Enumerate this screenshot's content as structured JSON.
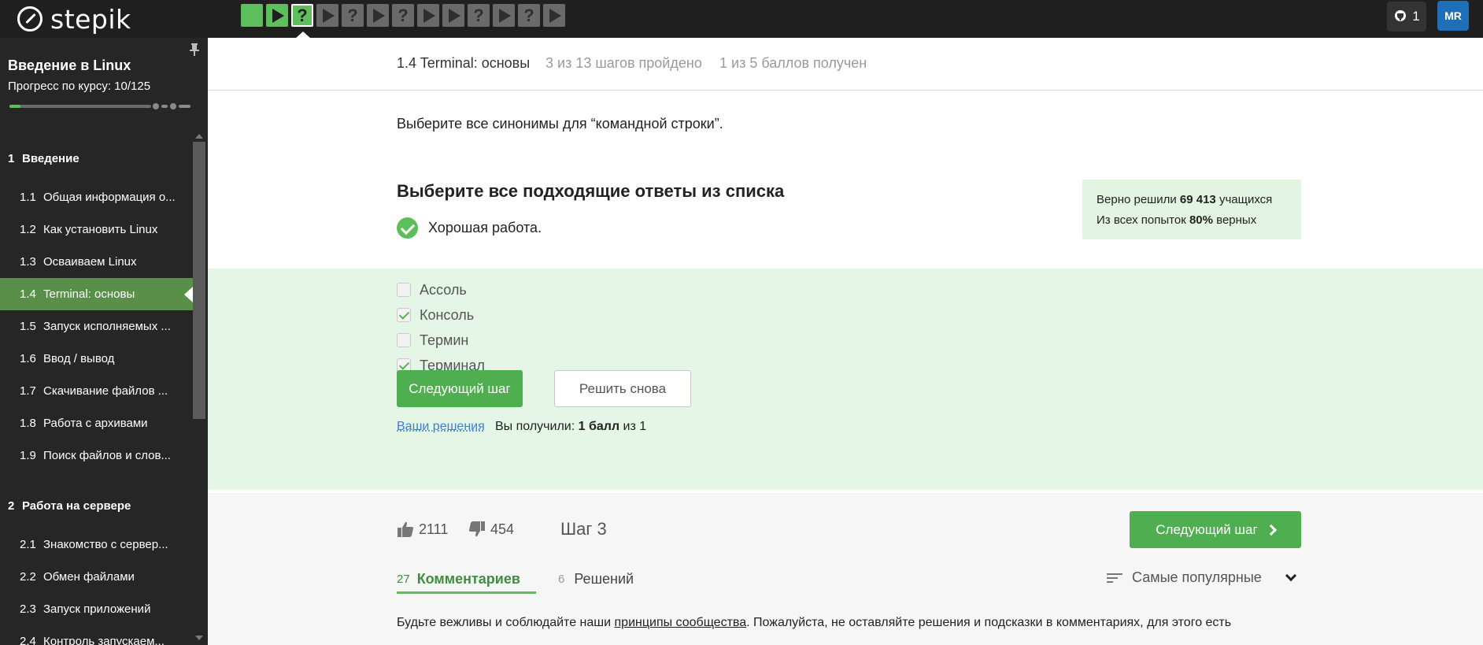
{
  "brand": {
    "name": "stepik"
  },
  "steps": [
    {
      "kind": "done"
    },
    {
      "kind": "video-done"
    },
    {
      "kind": "quiz-current"
    },
    {
      "kind": "video"
    },
    {
      "kind": "quiz"
    },
    {
      "kind": "video"
    },
    {
      "kind": "quiz"
    },
    {
      "kind": "video"
    },
    {
      "kind": "video"
    },
    {
      "kind": "quiz"
    },
    {
      "kind": "video"
    },
    {
      "kind": "quiz"
    },
    {
      "kind": "video"
    }
  ],
  "step_glyphs": {
    "quiz": "?"
  },
  "header_right": {
    "trophy_count": "1",
    "avatar_initials": "MR"
  },
  "sidebar": {
    "course_title": "Введение в Linux",
    "progress_text": "Прогресс по курсу:  10/125",
    "progress_fraction": 0.08,
    "modules": [
      {
        "title_num": "1",
        "title": "Введение",
        "lessons": [
          {
            "num": "1.1",
            "title": "Общая информация о..."
          },
          {
            "num": "1.2",
            "title": "Как установить Linux"
          },
          {
            "num": "1.3",
            "title": "Осваиваем Linux"
          },
          {
            "num": "1.4",
            "title": "Terminal: основы",
            "active": true
          },
          {
            "num": "1.5",
            "title": "Запуск исполняемых ..."
          },
          {
            "num": "1.6",
            "title": "Ввод / вывод"
          },
          {
            "num": "1.7",
            "title": "Скачивание файлов ..."
          },
          {
            "num": "1.8",
            "title": "Работа с архивами"
          },
          {
            "num": "1.9",
            "title": "Поиск файлов и слов..."
          }
        ]
      },
      {
        "title_num": "2",
        "title": "Работа на сервере",
        "lessons": [
          {
            "num": "2.1",
            "title": "Знакомство с сервер..."
          },
          {
            "num": "2.2",
            "title": "Обмен файлами"
          },
          {
            "num": "2.3",
            "title": "Запуск приложений"
          },
          {
            "num": "2.4",
            "title": "Контроль запускаем..."
          }
        ]
      }
    ]
  },
  "lesson_header": {
    "title": "1.4 Terminal: основы",
    "steps_done": "3 из 13 шагов пройдено",
    "score": "1 из 5 баллов  получен"
  },
  "question": "Выберите все синонимы для “командной строки”.",
  "subtitle": "Выберите все подходящие ответы из списка",
  "feedback": "Хорошая работа.",
  "stats": {
    "line1_pre": "Верно решили ",
    "line1_num": "69 413",
    "line1_post": " учащихся",
    "line2_pre": "Из всех попыток ",
    "line2_num": "80%",
    "line2_post": " верных"
  },
  "options": [
    {
      "label": "Ассоль",
      "checked": false
    },
    {
      "label": "Консоль",
      "checked": true
    },
    {
      "label": "Термин",
      "checked": false
    },
    {
      "label": "Терминал",
      "checked": true
    }
  ],
  "buttons": {
    "next": "Следующий шаг",
    "retry": "Решить снова"
  },
  "result": {
    "your_solutions": "Ваши решения",
    "got_pre": "Вы получили: ",
    "got_bold": "1 балл",
    "got_post": " из 1"
  },
  "footer": {
    "likes": "2111",
    "dislikes": "454",
    "step_label": "Шаг 3",
    "next_button": "Следующий шаг",
    "comments_count": "27",
    "comments_label": "Комментариев",
    "solutions_count": "6",
    "solutions_label": "Решений",
    "sort_label": "Самые популярные",
    "rules_pre": "Будьте вежливы и соблюдайте наши ",
    "rules_link": "принципы сообщества",
    "rules_post": ". Пожалуйста, не оставляйте решения и подсказки в комментариях, для этого есть"
  },
  "colors": {
    "accent": "#5cbf5b",
    "button": "#4fae4f",
    "link": "#3b7ed6",
    "topbar": "#1f1f1f",
    "sidebar": "#262626"
  }
}
